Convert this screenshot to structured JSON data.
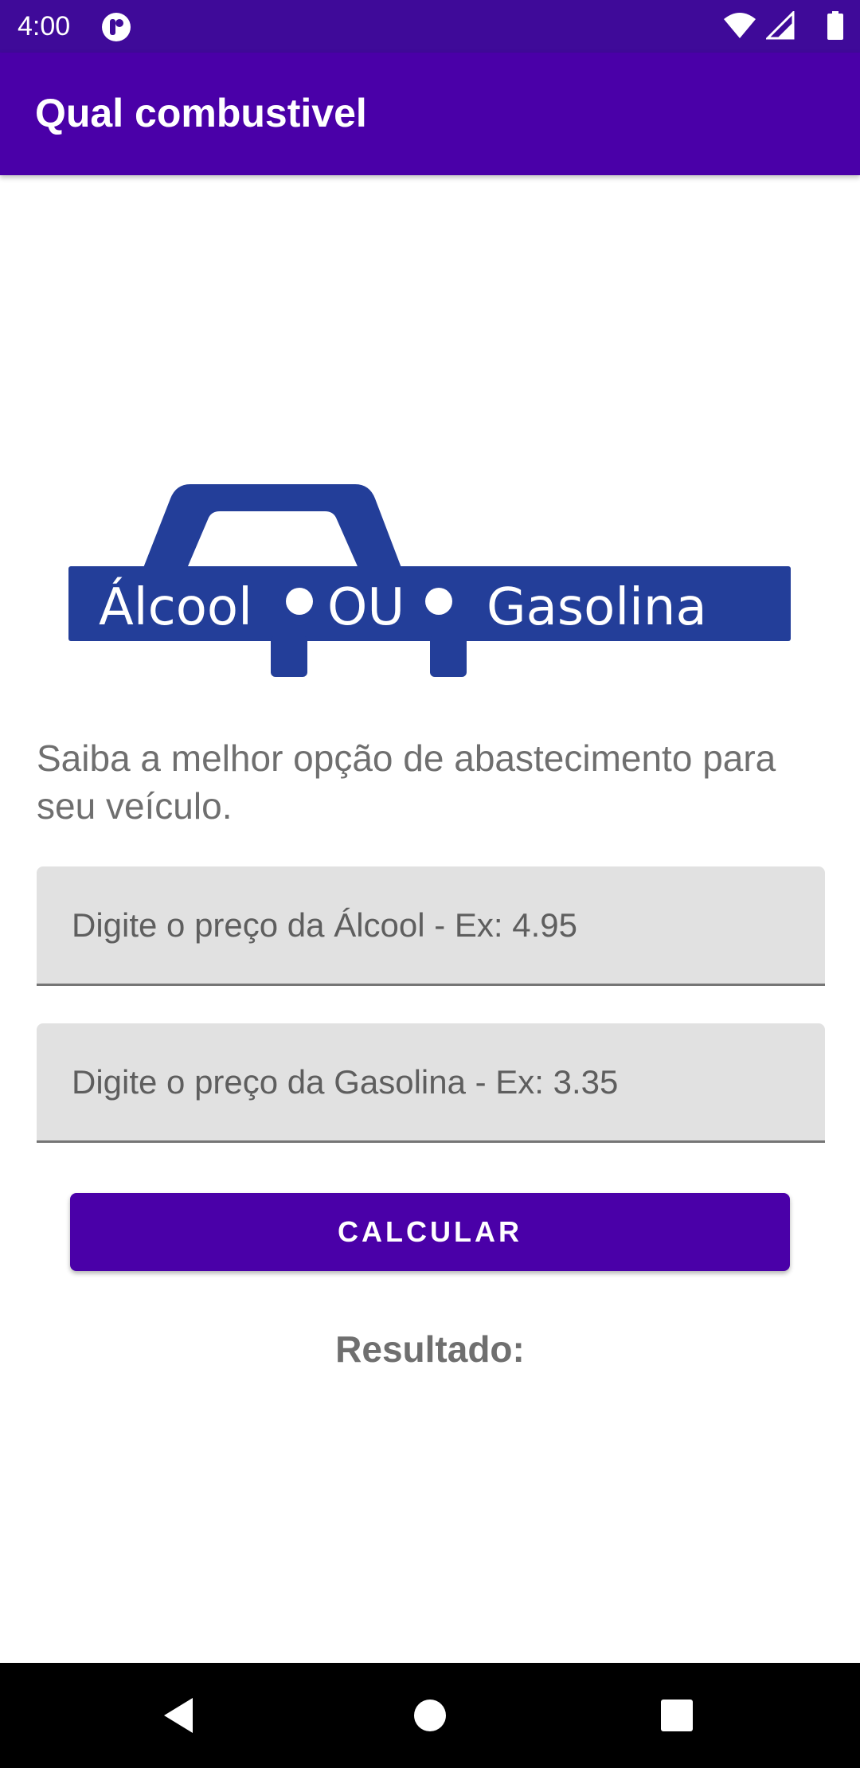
{
  "status_bar": {
    "time": "4:00",
    "icons": [
      "app-notification-icon",
      "wifi-icon",
      "cell-signal-icon",
      "battery-icon"
    ]
  },
  "app_bar": {
    "title": "Qual combustivel"
  },
  "logo": {
    "word_left": "Álcool",
    "word_middle": "OU",
    "word_right": "Gasolina",
    "color": "#233e99"
  },
  "main": {
    "description": "Saiba a melhor opção de abastecimento para seu veículo.",
    "alcool_input": {
      "placeholder": "Digite o preço da Álcool - Ex: 4.95",
      "value": ""
    },
    "gasolina_input": {
      "placeholder": "Digite o preço da Gasolina - Ex: 3.35",
      "value": ""
    },
    "calculate_label": "CALCULAR",
    "result_label": "Resultado:"
  },
  "nav_bar": {
    "buttons": [
      "back-icon",
      "home-icon",
      "recent-apps-icon"
    ]
  },
  "colors": {
    "status_bar": "#3f0a99",
    "primary": "#4a00a8",
    "logo_blue": "#233e99",
    "text_secondary": "#6f6f6f",
    "field_bg": "#e1e1e1"
  }
}
